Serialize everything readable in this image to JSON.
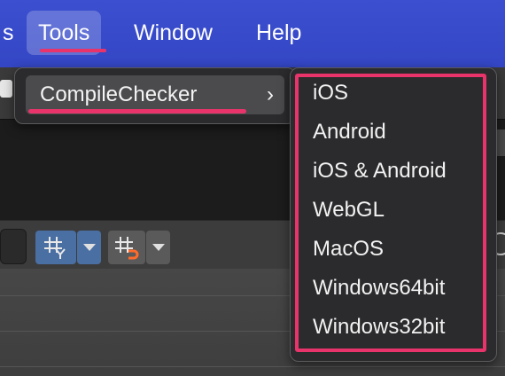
{
  "menubar": {
    "items": [
      "s",
      "Tools",
      "Window",
      "Help"
    ]
  },
  "tools_menu": {
    "items": [
      {
        "label": "CompileChecker",
        "submenu_indicator": "›"
      }
    ]
  },
  "compile_checker_menu": {
    "options": [
      "iOS",
      "Android",
      "iOS & Android",
      "WebGL",
      "MacOS",
      "Windows64bit",
      "Windows32bit"
    ]
  },
  "toolbar": {
    "icons": [
      "grid-snap-y-icon",
      "grid-snap-magnet-icon"
    ]
  },
  "colors": {
    "menubar": "#3b4fd0",
    "highlight_annotation": "#e8346a",
    "menu_background": "#2b2b2d",
    "menu_selected": "#4b4b4e"
  }
}
